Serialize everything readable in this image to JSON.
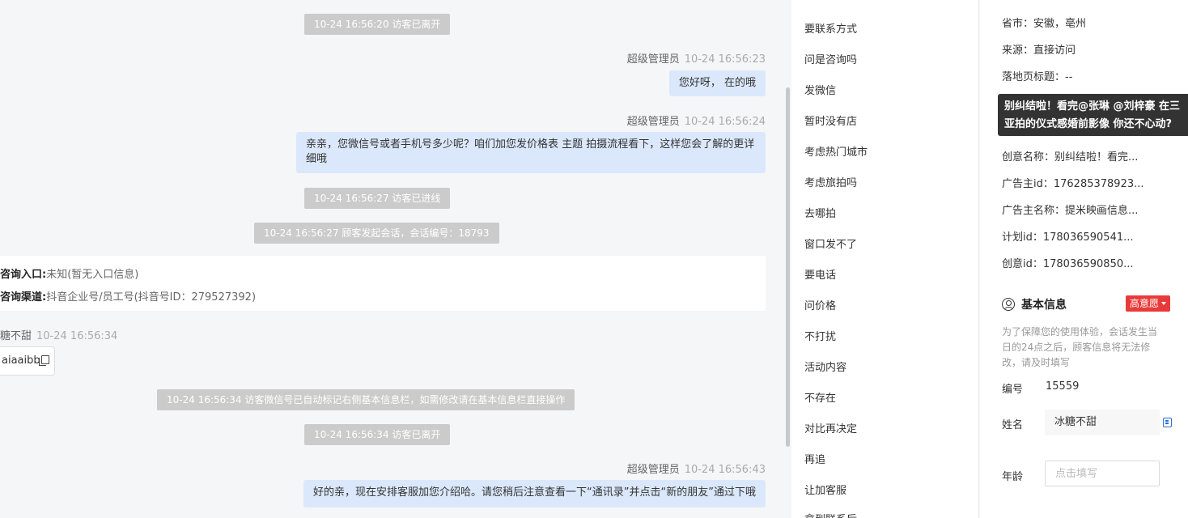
{
  "chat": {
    "sys1": "10-24 16:56:20 访客已离开",
    "msg1": {
      "sender": "超级管理员",
      "time": "10-24 16:56:23",
      "text": "您好呀， 在的哦"
    },
    "msg2": {
      "sender": "超级管理员",
      "time": "10-24 16:56:24",
      "line1": "亲亲，您微信号或者手机号多少呢？咱们加您发价格表 主题 拍摄流程看下，这样您会了解的更详",
      "line2": "细哦"
    },
    "sys2": "10-24 16:56:27 访客已进线",
    "sys3": "10-24 16:56:27 顾客发起会话，会话编号：18793",
    "card": {
      "entry_label": "咨询入口:",
      "entry_value": "未知(暂无入口信息)",
      "channel_label": "咨询渠道:",
      "channel_value": "抖音企业号/员工号(抖音号ID：279527392)"
    },
    "visitor": {
      "name": "糖不甜",
      "time": "10-24 16:56:34",
      "wechat": "aiaaibb"
    },
    "sys4": "10-24 16:56:34 访客微信号已自动标记右侧基本信息栏，如需修改请在基本信息栏直接操作",
    "sys5": "10-24 16:56:34 访客已离开",
    "msg3": {
      "sender": "超级管理员",
      "time": "10-24 16:56:43",
      "text": "好的亲，现在安排客服加您介绍哈。请您稍后注意查看一下“通讯录”并点击“新的朋友”通过下哦"
    }
  },
  "quick_replies": [
    "要联系方式",
    "问是咨询吗",
    "发微信",
    "暂时没有店",
    "考虑热门城市",
    "考虑旅拍吗",
    "去哪拍",
    "窗口发不了",
    "要电话",
    "问价格",
    "不打扰",
    "活动内容",
    "不存在",
    "对比再决定",
    "再追",
    "让加客服",
    "拿到联系后"
  ],
  "info": {
    "province": "省市：安徽，亳州",
    "source": "来源：直接访问",
    "landing_title": "落地页标题：--",
    "tooltip_line1": "别纠结啦！看完@张琳 @刘梓豪 在三",
    "tooltip_line2": "亚拍的仪式感婚前影像 你还不心动?",
    "creative_name": "创意名称：别纠结啦！看完...",
    "advertiser_id": "广告主id：176285378923...",
    "advertiser_name": "广告主名称：提米映画信息...",
    "plan_id": "计划id：178036590541...",
    "creative_id": "创意id：178036590850...",
    "basic_title": "基本信息",
    "intent_badge": "高意愿",
    "intent_color": "#e93a3a",
    "note": "为了保障您的使用体验，会话发生当日的24点之后，顾客信息将无法修改，请及时填写",
    "number_label": "编号",
    "number_value": "15559",
    "name_label": "姓名",
    "name_value": "冰糖不甜",
    "age_label": "年龄",
    "age_placeholder": "点击填写"
  },
  "colors": {
    "bubble": "#dbe8fb",
    "system": "#cbcbcb",
    "accent": "#2a6ed8"
  }
}
